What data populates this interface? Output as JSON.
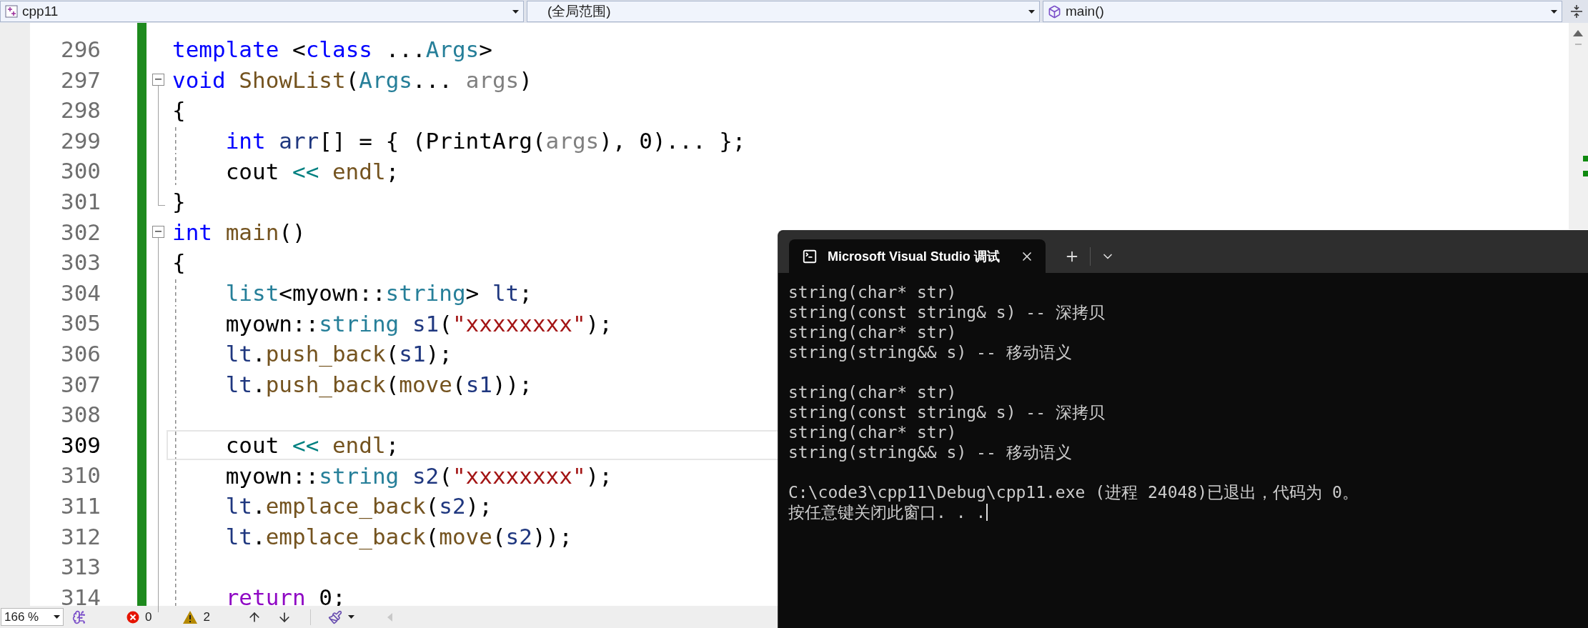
{
  "toolbar": {
    "project": "cpp11",
    "scope": "(全局范围)",
    "member": "main()"
  },
  "editor": {
    "lines": [
      {
        "number": "296",
        "outlined": false,
        "collapse_box": false,
        "fold_end": false,
        "indented": false,
        "current": false,
        "tokens": [
          {
            "text": "template",
            "kind": "keyword"
          },
          {
            "text": " <",
            "kind": "plain"
          },
          {
            "text": "class",
            "kind": "keyword"
          },
          {
            "text": " ...",
            "kind": "plain"
          },
          {
            "text": "Args",
            "kind": "type"
          },
          {
            "text": ">",
            "kind": "plain"
          }
        ]
      },
      {
        "number": "297",
        "outlined": true,
        "collapse_box": true,
        "fold_end": false,
        "indented": false,
        "current": false,
        "tokens": [
          {
            "text": "void ",
            "kind": "keyword"
          },
          {
            "text": "ShowList",
            "kind": "function"
          },
          {
            "text": "(",
            "kind": "plain"
          },
          {
            "text": "Args",
            "kind": "type"
          },
          {
            "text": "... ",
            "kind": "plain"
          },
          {
            "text": "args",
            "kind": "param"
          },
          {
            "text": ")",
            "kind": "plain"
          }
        ]
      },
      {
        "number": "298",
        "outlined": true,
        "collapse_box": false,
        "fold_end": false,
        "indented": false,
        "current": false,
        "tokens": [
          {
            "text": "{",
            "kind": "plain"
          }
        ]
      },
      {
        "number": "299",
        "outlined": true,
        "collapse_box": false,
        "fold_end": false,
        "indented": true,
        "current": false,
        "tokens": [
          {
            "text": "int ",
            "kind": "keyword"
          },
          {
            "text": "arr",
            "kind": "variable"
          },
          {
            "text": "[] = { (PrintArg(",
            "kind": "plain"
          },
          {
            "text": "args",
            "kind": "param"
          },
          {
            "text": "), 0)... };",
            "kind": "plain"
          }
        ]
      },
      {
        "number": "300",
        "outlined": true,
        "collapse_box": false,
        "fold_end": false,
        "indented": true,
        "current": false,
        "tokens": [
          {
            "text": "cout ",
            "kind": "plain"
          },
          {
            "text": "<<",
            "kind": "operator"
          },
          {
            "text": " endl",
            "kind": "function"
          },
          {
            "text": ";",
            "kind": "plain"
          }
        ]
      },
      {
        "number": "301",
        "outlined": true,
        "collapse_box": false,
        "fold_end": true,
        "indented": false,
        "current": false,
        "tokens": [
          {
            "text": "}",
            "kind": "plain"
          }
        ]
      },
      {
        "number": "302",
        "outlined": true,
        "collapse_box": true,
        "fold_end": false,
        "indented": false,
        "current": false,
        "tokens": [
          {
            "text": "int ",
            "kind": "keyword"
          },
          {
            "text": "main",
            "kind": "function"
          },
          {
            "text": "()",
            "kind": "plain"
          }
        ]
      },
      {
        "number": "303",
        "outlined": true,
        "collapse_box": false,
        "fold_end": false,
        "indented": false,
        "current": false,
        "tokens": [
          {
            "text": "{",
            "kind": "plain"
          }
        ]
      },
      {
        "number": "304",
        "outlined": true,
        "collapse_box": false,
        "fold_end": false,
        "indented": true,
        "current": false,
        "tokens": [
          {
            "text": "list",
            "kind": "type"
          },
          {
            "text": "<myown::",
            "kind": "plain"
          },
          {
            "text": "string",
            "kind": "type"
          },
          {
            "text": "> ",
            "kind": "plain"
          },
          {
            "text": "lt",
            "kind": "variable"
          },
          {
            "text": ";",
            "kind": "plain"
          }
        ]
      },
      {
        "number": "305",
        "outlined": true,
        "collapse_box": false,
        "fold_end": false,
        "indented": true,
        "current": false,
        "tokens": [
          {
            "text": "myown::",
            "kind": "plain"
          },
          {
            "text": "string ",
            "kind": "type"
          },
          {
            "text": "s1",
            "kind": "variable"
          },
          {
            "text": "(",
            "kind": "plain"
          },
          {
            "text": "\"xxxxxxxx\"",
            "kind": "string"
          },
          {
            "text": ");",
            "kind": "plain"
          }
        ]
      },
      {
        "number": "306",
        "outlined": true,
        "collapse_box": false,
        "fold_end": false,
        "indented": true,
        "current": false,
        "tokens": [
          {
            "text": "lt",
            "kind": "variable"
          },
          {
            "text": ".",
            "kind": "plain"
          },
          {
            "text": "push_back",
            "kind": "function"
          },
          {
            "text": "(",
            "kind": "plain"
          },
          {
            "text": "s1",
            "kind": "variable"
          },
          {
            "text": ");",
            "kind": "plain"
          }
        ]
      },
      {
        "number": "307",
        "outlined": true,
        "collapse_box": false,
        "fold_end": false,
        "indented": true,
        "current": false,
        "tokens": [
          {
            "text": "lt",
            "kind": "variable"
          },
          {
            "text": ".",
            "kind": "plain"
          },
          {
            "text": "push_back",
            "kind": "function"
          },
          {
            "text": "(",
            "kind": "plain"
          },
          {
            "text": "move",
            "kind": "function"
          },
          {
            "text": "(",
            "kind": "plain"
          },
          {
            "text": "s1",
            "kind": "variable"
          },
          {
            "text": "));",
            "kind": "plain"
          }
        ]
      },
      {
        "number": "308",
        "outlined": true,
        "collapse_box": false,
        "fold_end": false,
        "indented": true,
        "current": false
      },
      {
        "number": "309",
        "outlined": true,
        "collapse_box": false,
        "fold_end": false,
        "indented": true,
        "current": true,
        "tokens": [
          {
            "text": "cout ",
            "kind": "plain"
          },
          {
            "text": "<<",
            "kind": "operator"
          },
          {
            "text": " endl",
            "kind": "function"
          },
          {
            "text": ";",
            "kind": "plain"
          }
        ]
      },
      {
        "number": "310",
        "outlined": true,
        "collapse_box": false,
        "fold_end": false,
        "indented": true,
        "current": false,
        "tokens": [
          {
            "text": "myown::",
            "kind": "plain"
          },
          {
            "text": "string ",
            "kind": "type"
          },
          {
            "text": "s2",
            "kind": "variable"
          },
          {
            "text": "(",
            "kind": "plain"
          },
          {
            "text": "\"xxxxxxxx\"",
            "kind": "string"
          },
          {
            "text": ");",
            "kind": "plain"
          }
        ]
      },
      {
        "number": "311",
        "outlined": true,
        "collapse_box": false,
        "fold_end": false,
        "indented": true,
        "current": false,
        "tokens": [
          {
            "text": "lt",
            "kind": "variable"
          },
          {
            "text": ".",
            "kind": "plain"
          },
          {
            "text": "emplace_back",
            "kind": "function"
          },
          {
            "text": "(",
            "kind": "plain"
          },
          {
            "text": "s2",
            "kind": "variable"
          },
          {
            "text": ");",
            "kind": "plain"
          }
        ]
      },
      {
        "number": "312",
        "outlined": true,
        "collapse_box": false,
        "fold_end": false,
        "indented": true,
        "current": false,
        "tokens": [
          {
            "text": "lt",
            "kind": "variable"
          },
          {
            "text": ".",
            "kind": "plain"
          },
          {
            "text": "emplace_back",
            "kind": "function"
          },
          {
            "text": "(",
            "kind": "plain"
          },
          {
            "text": "move",
            "kind": "function"
          },
          {
            "text": "(",
            "kind": "plain"
          },
          {
            "text": "s2",
            "kind": "variable"
          },
          {
            "text": "));",
            "kind": "plain"
          }
        ]
      },
      {
        "number": "313",
        "outlined": true,
        "collapse_box": false,
        "fold_end": false,
        "indented": true,
        "current": false
      },
      {
        "number": "314",
        "outlined": true,
        "collapse_box": false,
        "fold_end": false,
        "indented": true,
        "current": false,
        "tokens": [
          {
            "text": "return",
            "kind": "control"
          },
          {
            "text": " 0;",
            "kind": "plain"
          }
        ]
      }
    ]
  },
  "status_bar": {
    "zoom": "166 %",
    "errors": "0",
    "warnings": "2"
  },
  "terminal": {
    "tab_title": "Microsoft Visual Studio 调试",
    "cursor": true,
    "output_blocks": [
      [
        "string(char* str)",
        "string(const string& s) -- 深拷贝",
        "string(char* str)",
        "string(string&& s) -- 移动语义"
      ],
      [
        "string(char* str)",
        "string(const string& s) -- 深拷贝",
        "string(char* str)",
        "string(string&& s) -- 移动语义"
      ],
      [
        "C:\\code3\\cpp11\\Debug\\cpp11.exe (进程 24048)已退出，代码为 0。",
        "按任意键关闭此窗口. . ."
      ]
    ]
  }
}
